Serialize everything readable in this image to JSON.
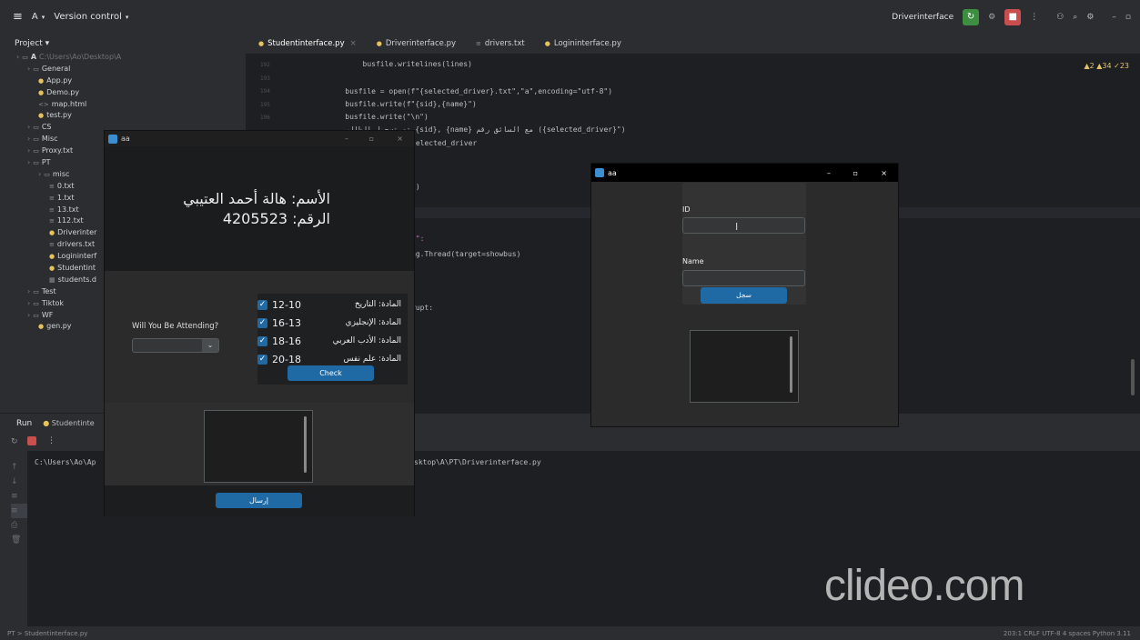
{
  "ide": {
    "menu": "≡",
    "project_letter": "A",
    "version_control": "Version control",
    "run_config": "Driverinterface",
    "project_label": "Project",
    "tree": [
      {
        "label": "A",
        "path": "C:\\Users\\Ao\\Desktop\\A",
        "indent": 0,
        "icon": "folder"
      },
      {
        "label": "General",
        "indent": 1,
        "icon": "folder"
      },
      {
        "label": "App.py",
        "indent": 2,
        "icon": "py"
      },
      {
        "label": "Demo.py",
        "indent": 2,
        "icon": "py"
      },
      {
        "label": "map.html",
        "indent": 2,
        "icon": "html"
      },
      {
        "label": "test.py",
        "indent": 2,
        "icon": "py"
      },
      {
        "label": "CS",
        "indent": 1,
        "icon": "folder"
      },
      {
        "label": "Misc",
        "indent": 1,
        "icon": "folder"
      },
      {
        "label": "Proxy.txt",
        "indent": 1,
        "icon": "folder"
      },
      {
        "label": "PT",
        "indent": 1,
        "icon": "folder"
      },
      {
        "label": "misc",
        "indent": 2,
        "icon": "folder"
      },
      {
        "label": "0.txt",
        "indent": 3,
        "icon": "txt"
      },
      {
        "label": "1.txt",
        "indent": 3,
        "icon": "txt"
      },
      {
        "label": "13.txt",
        "indent": 3,
        "icon": "txt"
      },
      {
        "label": "112.txt",
        "indent": 3,
        "icon": "txt"
      },
      {
        "label": "Driverinter",
        "indent": 3,
        "icon": "py"
      },
      {
        "label": "drivers.txt",
        "indent": 3,
        "icon": "txt"
      },
      {
        "label": "Logininterf",
        "indent": 3,
        "icon": "py"
      },
      {
        "label": "Studentint",
        "indent": 3,
        "icon": "py"
      },
      {
        "label": "students.d",
        "indent": 3,
        "icon": "db"
      },
      {
        "label": "Test",
        "indent": 1,
        "icon": "folder"
      },
      {
        "label": "Tiktok",
        "indent": 1,
        "icon": "folder"
      },
      {
        "label": "WF",
        "indent": 1,
        "icon": "folder"
      },
      {
        "label": "gen.py",
        "indent": 2,
        "icon": "py"
      }
    ],
    "tabs": [
      {
        "label": "Studentinterface.py",
        "active": true,
        "closable": true,
        "icon": "py"
      },
      {
        "label": "Driverinterface.py",
        "icon": "py"
      },
      {
        "label": "drivers.txt",
        "icon": "txt"
      },
      {
        "label": "Logininterface.py",
        "icon": "py"
      }
    ],
    "inspections": "▲2 ▲34 ✓23",
    "line_numbers": [
      "192",
      "193",
      "194",
      "195",
      "196"
    ],
    "code": [
      "        busfile.writelines(lines)",
      "",
      "    busfile = open(f\"{selected_driver}.txt\",\"a\",encoding=\"utf-8\")",
      "    busfile.write(f\"{sid},{name}\")",
      "    busfile.write(\"\\n\")",
      "    تم تسجيل الطالب {sid}, {name} مع السائق رقم ({selected_driver}\")",
      "selected_driver"
    ],
    "code_fragments": [
      "\")",
      "t\":",
      "ng.Thread(target=showbus)",
      ")",
      "rupt:"
    ],
    "run_label": "Run",
    "run_tab": "Studentinte",
    "console_prefix": "C:\\Users\\Ao\\Ap",
    "console_suffix": "sktop\\A\\PT\\Driverinterface.py",
    "breadcrumb": "PT  >  Studentinterface.py",
    "status": "203:1  CRLF  UTF-8  4 spaces  Python 3.11"
  },
  "student_window": {
    "title": "aa",
    "name_line": "الأسم: هالة أحمد العتيبي",
    "id_line": "الرقم: 4205523",
    "attending_label": "Will You Be Attending?",
    "subjects": [
      {
        "text": "المادة: التاريخ",
        "time": "12-10",
        "checked": true
      },
      {
        "text": "المادة: الإنجليزي",
        "time": "16-13",
        "checked": true
      },
      {
        "text": "المادة: الأدب العربي",
        "time": "18-16",
        "checked": true
      },
      {
        "text": "المادة: علم نفس",
        "time": "20-18",
        "checked": true
      }
    ],
    "check_button": "Check",
    "send_button": "إرسال"
  },
  "driver_window": {
    "title": "aa",
    "id_label": "ID",
    "name_label": "Name",
    "register_button": "سجل"
  },
  "watermark": "clideo.com"
}
